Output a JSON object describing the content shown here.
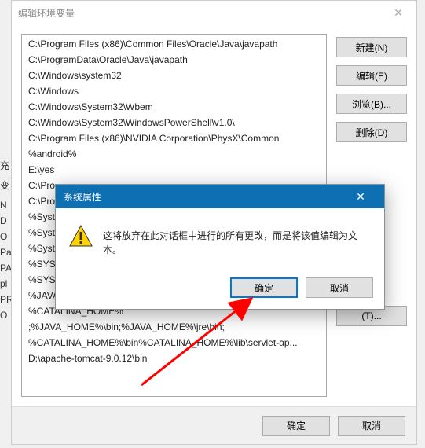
{
  "window": {
    "title": "编辑环境变量"
  },
  "list_items": [
    "C:\\Program Files (x86)\\Common Files\\Oracle\\Java\\javapath",
    "C:\\ProgramData\\Oracle\\Java\\javapath",
    "C:\\Windows\\system32",
    "C:\\Windows",
    "C:\\Windows\\System32\\Wbem",
    "C:\\Windows\\System32\\WindowsPowerShell\\v1.0\\",
    "C:\\Program Files (x86)\\NVIDIA Corporation\\PhysX\\Common",
    "%android%",
    "E:\\yes",
    "C:\\Pro",
    "C:\\Pro",
    "%Syst",
    "%Syst",
    "%Syst",
    "%SYS",
    "%SYS",
    "%JAVA_HOME%\\bin",
    "%CATALINA_HOME%",
    ";%JAVA_HOME%\\bin;%JAVA_HOME%\\jre\\bin;",
    "%CATALINA_HOME%\\bin%CATALINA_HOME%\\lib\\servlet-ap...",
    "D:\\apache-tomcat-9.0.12\\bin"
  ],
  "side_buttons": {
    "new": "新建(N)",
    "edit": "编辑(E)",
    "browse": "浏览(B)...",
    "delete": "删除(D)",
    "edit_text": "(T)..."
  },
  "footer": {
    "ok": "确定",
    "cancel": "取消"
  },
  "modal": {
    "title": "系统属性",
    "message": "这将放弃在此对话框中进行的所有更改，而是将该值编辑为文本。",
    "ok": "确定",
    "cancel": "取消"
  },
  "bg_fragments": [
    "充",
    "变",
    "N",
    "D",
    "O",
    "Pa",
    "PA",
    "pl",
    "PR",
    "O"
  ]
}
